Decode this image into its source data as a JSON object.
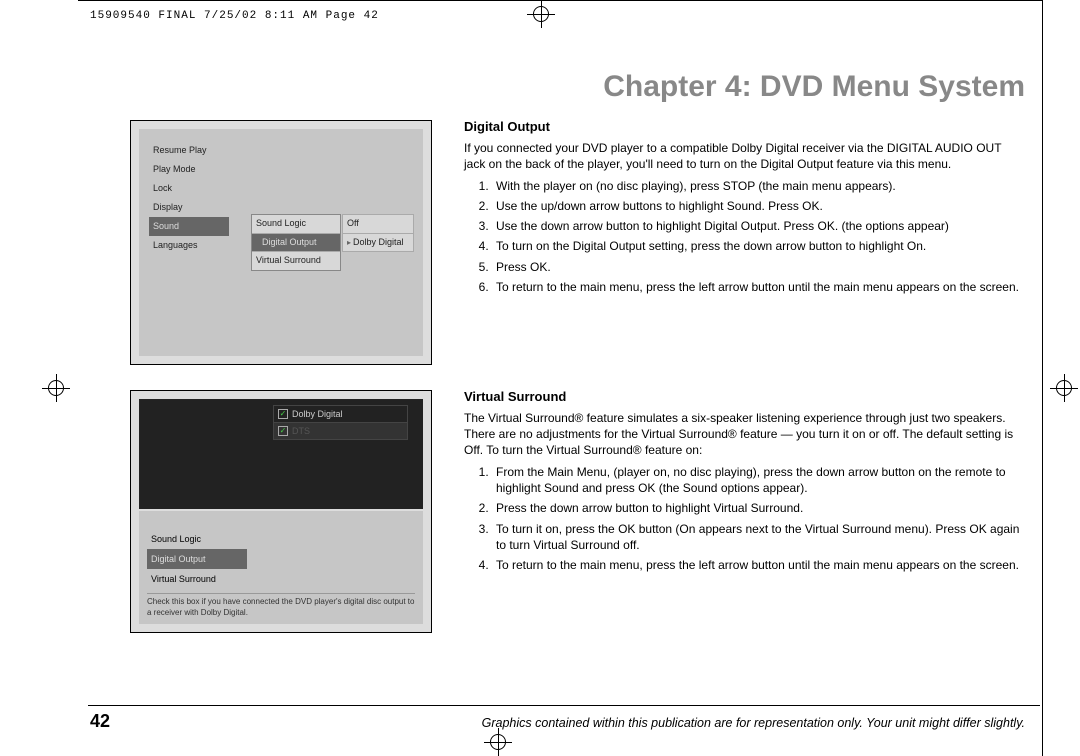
{
  "header": "15909540 FINAL  7/25/02  8:11 AM  Page 42",
  "chapter_title": "Chapter 4: DVD Menu System",
  "screenshot1": {
    "left_menu": [
      "Resume Play",
      "Play Mode",
      "Lock",
      "Display",
      "Sound",
      "Languages"
    ],
    "left_highlight_index": 4,
    "col2": [
      "Sound Logic",
      "Digital Output",
      "Virtual Surround"
    ],
    "col2_highlight_index": 1,
    "col3": [
      "Off",
      "Dolby Digital"
    ],
    "col3_arrow_on_index": 1
  },
  "screenshot2": {
    "dark_options": [
      {
        "label": "Dolby Digital",
        "checked": true,
        "dim": false
      },
      {
        "label": "DTS",
        "checked": true,
        "dim": true
      }
    ],
    "lower_list": [
      "Sound Logic",
      "Digital Output",
      "Virtual Surround"
    ],
    "lower_highlight_index": 1,
    "caption": "Check this box if you have connected the DVD player's digital disc output to a receiver with Dolby Digital."
  },
  "section1": {
    "heading": "Digital Output",
    "intro": "If you connected your DVD player to a compatible Dolby Digital receiver via the DIGITAL AUDIO OUT jack on the back of the player, you'll need to turn on the Digital Output feature via this menu.",
    "steps": [
      "With the player on (no disc playing), press STOP (the main menu appears).",
      "Use the up/down arrow buttons to highlight Sound. Press OK.",
      "Use the down arrow button to highlight Digital Output. Press OK. (the options appear)",
      "To turn on the Digital Output setting, press the down arrow button to highlight On.",
      "Press OK.",
      "To return to the main menu, press the left arrow button until the main menu appears on the screen."
    ]
  },
  "section2": {
    "heading": "Virtual Surround",
    "intro": "The Virtual Surround® feature simulates a six-speaker listening experience through just two speakers. There are no adjustments for the Virtual Surround® feature — you turn it on or off. The default setting is Off. To turn the Virtual Surround® feature on:",
    "steps": [
      "From the Main Menu, (player on, no disc playing), press the down arrow button on the remote to highlight Sound and press OK (the Sound options appear).",
      "Press the down arrow button to highlight Virtual Surround.",
      "To turn it on, press the OK button (On appears next to the Virtual Surround menu). Press OK again to turn Virtual Surround off.",
      "To return to the main menu, press the left arrow button until the main menu appears on the screen."
    ]
  },
  "page_number": "42",
  "footer_note": "Graphics contained within this publication are for representation only. Your unit might differ slightly."
}
